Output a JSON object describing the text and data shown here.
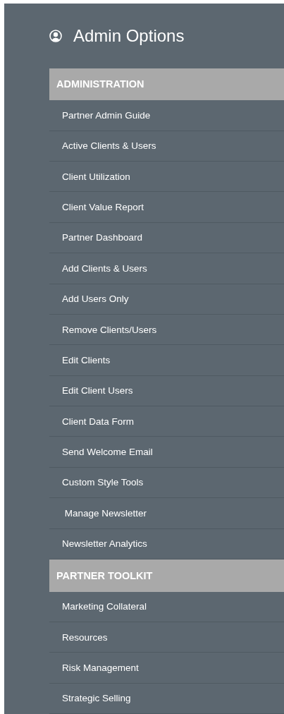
{
  "title": "Admin Options",
  "sections": [
    {
      "heading": "ADMINISTRATION",
      "items": [
        "Partner Admin Guide",
        "Active Clients & Users",
        "Client Utilization",
        "Client Value Report",
        "Partner Dashboard",
        "Add Clients & Users",
        "Add Users Only",
        "Remove Clients/Users",
        "Edit Clients",
        "Edit Client Users",
        "Client Data Form",
        "Send Welcome Email",
        "Custom Style Tools",
        " Manage Newsletter",
        "Newsletter Analytics"
      ]
    },
    {
      "heading": "PARTNER TOOLKIT",
      "items": [
        "Marketing Collateral",
        "Resources",
        "Risk Management",
        "Strategic Selling"
      ]
    }
  ]
}
